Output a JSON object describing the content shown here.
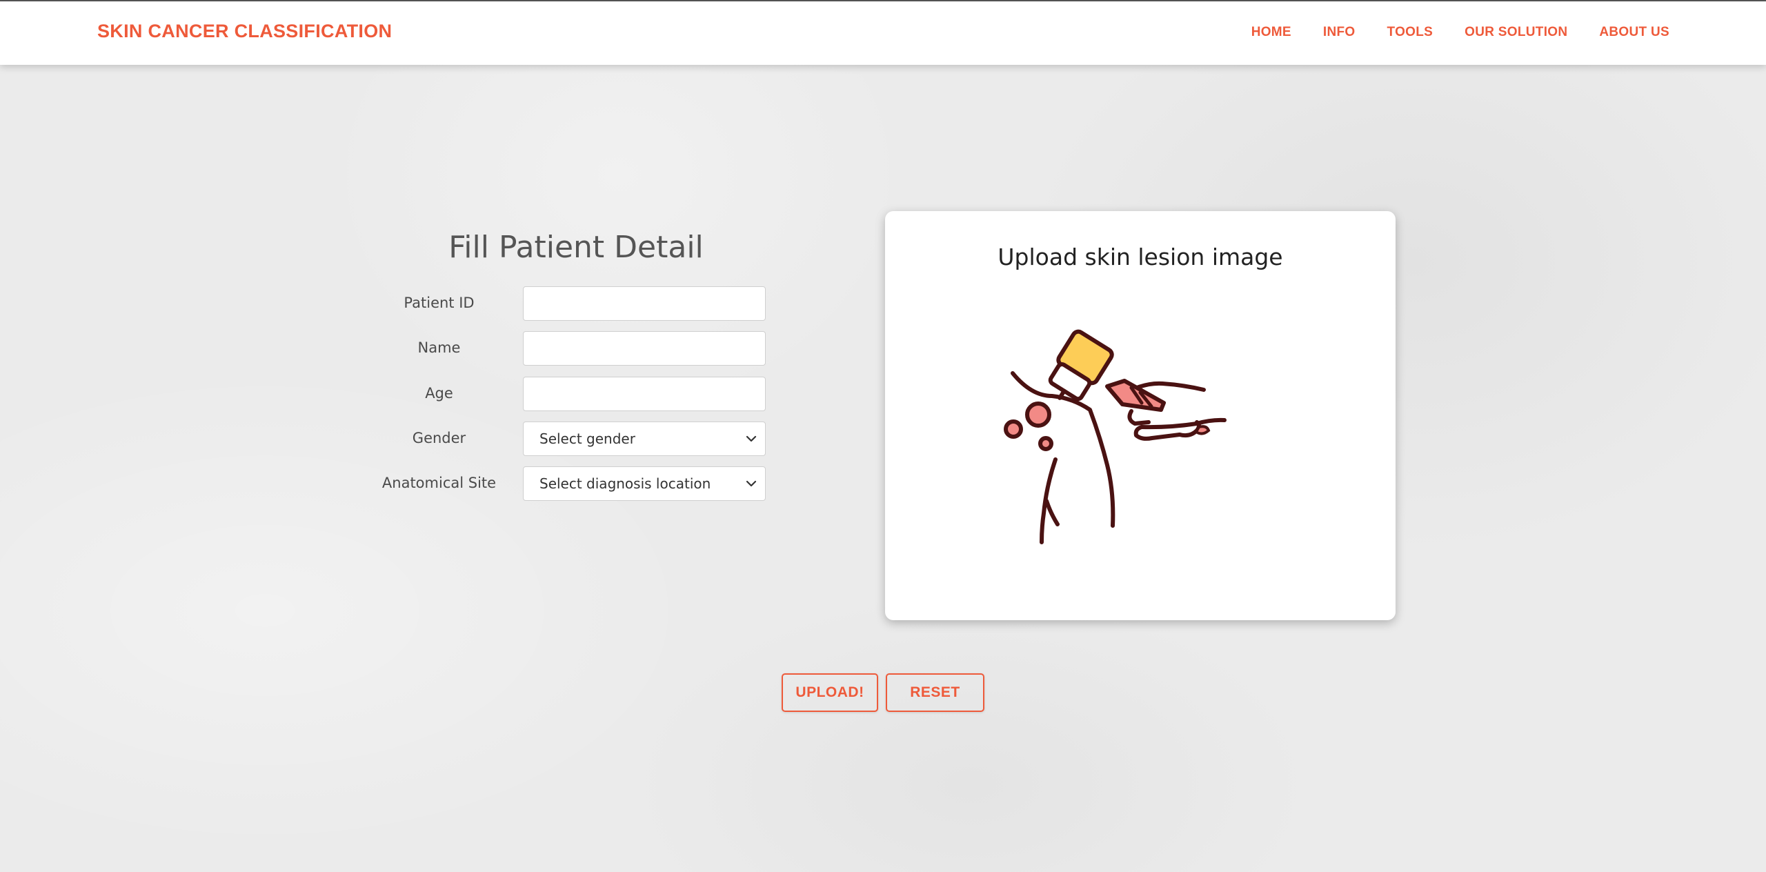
{
  "brand": "SKIN CANCER CLASSIFICATION",
  "nav": {
    "items": [
      "HOME",
      "INFO",
      "TOOLS",
      "OUR SOLUTION",
      "ABOUT US"
    ]
  },
  "form": {
    "title": "Fill Patient Detail",
    "fields": {
      "patient_id": {
        "label": "Patient ID",
        "value": ""
      },
      "name": {
        "label": "Name",
        "value": ""
      },
      "age": {
        "label": "Age",
        "value": ""
      },
      "gender": {
        "label": "Gender",
        "selected": "Select gender"
      },
      "site": {
        "label": "Anatomical Site",
        "selected": "Select diagnosis location"
      }
    }
  },
  "upload_card": {
    "title": "Upload skin lesion image",
    "illustration_icon": "dermatoscope-examining-skin-lesion-icon"
  },
  "buttons": {
    "upload": "UPLOAD!",
    "reset": "RESET"
  },
  "colors": {
    "accent": "#ee5a3a",
    "illustration_stroke": "#4a1212",
    "illustration_yellow": "#fdcd57",
    "illustration_pink": "#f28a86"
  }
}
